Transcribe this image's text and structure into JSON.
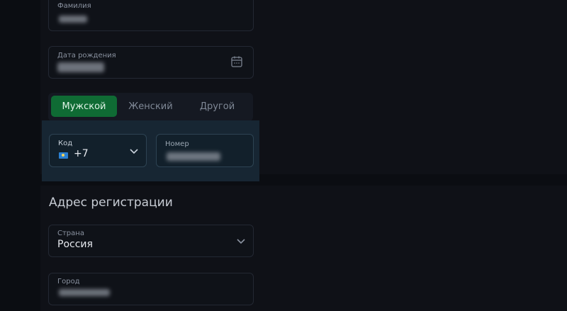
{
  "personal": {
    "last_name": {
      "label": "Фамилия",
      "value": ""
    },
    "birth_date": {
      "label": "Дата рождения",
      "value": "",
      "icon": "calendar-icon"
    },
    "gender": {
      "options": [
        "Мужской",
        "Женский",
        "Другой"
      ],
      "selected": "Мужской"
    }
  },
  "phone": {
    "code": {
      "label": "Код",
      "value": "+7",
      "flag": "flag-icon"
    },
    "number": {
      "label": "Номер",
      "value": ""
    }
  },
  "address": {
    "title": "Адрес регистрации",
    "country": {
      "label": "Страна",
      "value": "Россия"
    },
    "city": {
      "label": "Город",
      "value": ""
    }
  },
  "colors": {
    "background": "#0b0d12",
    "accent_green": "#0f6b34",
    "highlight_panel": "#172633"
  }
}
